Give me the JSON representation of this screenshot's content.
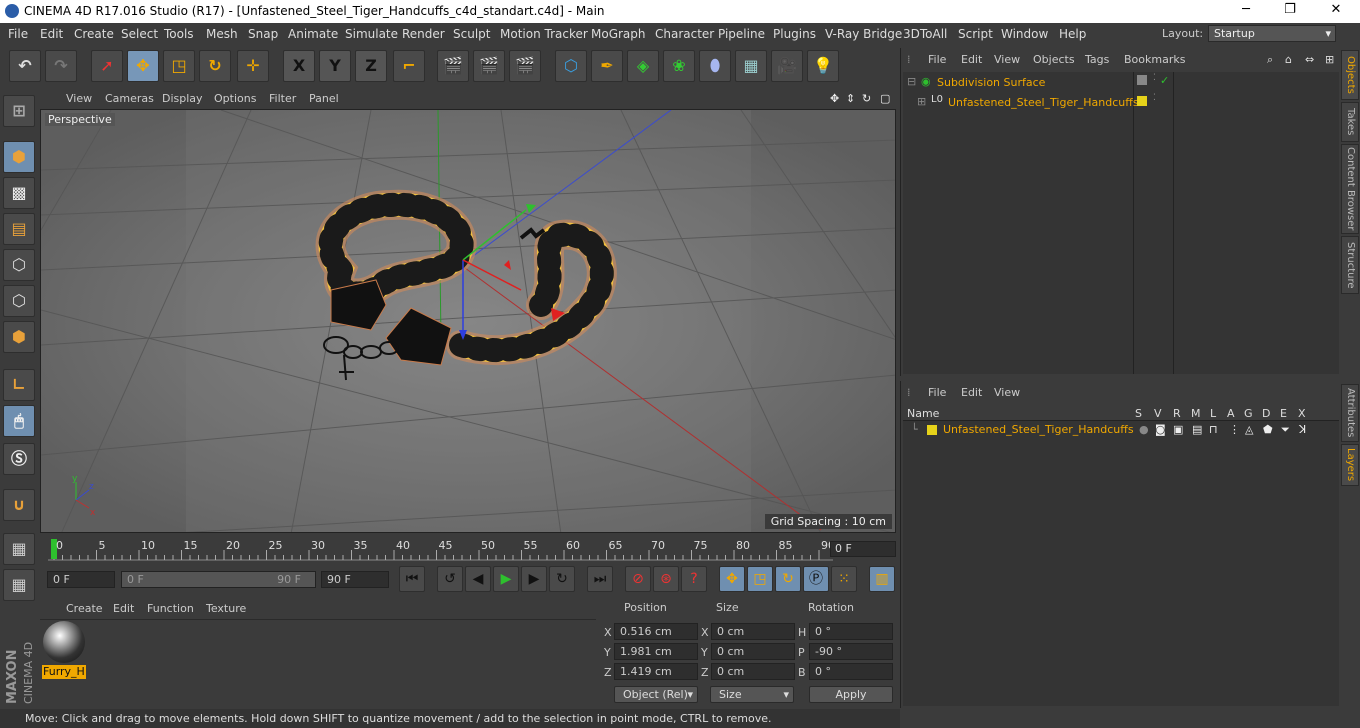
{
  "window": {
    "title": "CINEMA 4D R17.016 Studio (R17) - [Unfastened_Steel_Tiger_Handcuffs_c4d_standart.c4d] - Main"
  },
  "menu": [
    "File",
    "Edit",
    "Create",
    "Select",
    "Tools",
    "Mesh",
    "Snap",
    "Animate",
    "Simulate",
    "Render",
    "Sculpt",
    "Motion Tracker",
    "MoGraph",
    "Character",
    "Pipeline",
    "Plugins",
    "V-Ray Bridge",
    "3DToAll",
    "Script",
    "Window",
    "Help"
  ],
  "layout": {
    "label": "Layout:",
    "value": "Startup"
  },
  "toolbar": {
    "axis_x": "X",
    "axis_y": "Y",
    "axis_z": "Z"
  },
  "viewport": {
    "menu": [
      "View",
      "Cameras",
      "Display",
      "Options",
      "Filter",
      "Panel"
    ],
    "camera": "Perspective",
    "grid_spacing": "Grid Spacing : 10 cm"
  },
  "timeline": {
    "ticks": [
      "0",
      "5",
      "10",
      "15",
      "20",
      "25",
      "30",
      "35",
      "40",
      "45",
      "50",
      "55",
      "60",
      "65",
      "70",
      "75",
      "80",
      "85",
      "90"
    ],
    "current": "0 F",
    "start": "0 F",
    "range_start": "0 F",
    "range_end": "90 F",
    "end": "90 F"
  },
  "materials": {
    "menu": [
      "Create",
      "Edit",
      "Function",
      "Texture"
    ],
    "items": [
      {
        "name": "Furry_H"
      }
    ]
  },
  "coordinates": {
    "headers": {
      "position": "Position",
      "size": "Size",
      "rotation": "Rotation"
    },
    "rows": [
      {
        "axis": "X",
        "pos": "0.516 cm",
        "size": "0 cm",
        "rot_label": "H",
        "rot": "0 °"
      },
      {
        "axis": "Y",
        "pos": "1.981 cm",
        "size": "0 cm",
        "rot_label": "P",
        "rot": "-90 °"
      },
      {
        "axis": "Z",
        "pos": "1.419 cm",
        "size": "0 cm",
        "rot_label": "B",
        "rot": "0 °"
      }
    ],
    "mode": "Object (Rel)",
    "size_mode": "Size",
    "apply": "Apply"
  },
  "objects": {
    "menu": [
      "File",
      "Edit",
      "View",
      "Objects",
      "Tags",
      "Bookmarks"
    ],
    "items": [
      {
        "name": "Subdivision Surface"
      },
      {
        "name": "Unfastened_Steel_Tiger_Handcuffs"
      }
    ]
  },
  "layers": {
    "menu": [
      "File",
      "Edit",
      "View"
    ],
    "columns": [
      "Name",
      "S",
      "V",
      "R",
      "M",
      "L",
      "A",
      "G",
      "D",
      "E",
      "X"
    ],
    "items": [
      {
        "name": "Unfastened_Steel_Tiger_Handcuffs",
        "color": "#e6d21a"
      }
    ]
  },
  "right_tabs": [
    "Objects",
    "Takes",
    "Content Browser",
    "Structure",
    "Attributes",
    "Layers"
  ],
  "status": "Move: Click and drag to move elements. Hold down SHIFT to quantize movement / add to the selection in point mode, CTRL to remove.",
  "colors": {
    "accent": "#f0a800",
    "selected_tool": "#7797b8"
  }
}
